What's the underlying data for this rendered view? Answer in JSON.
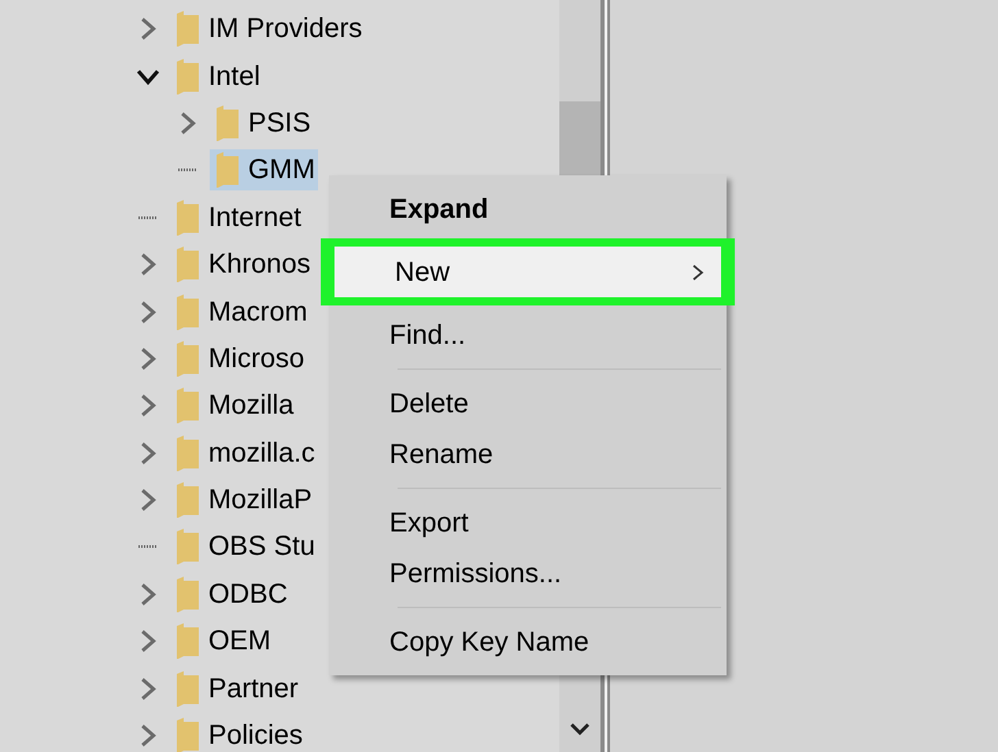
{
  "tree": [
    {
      "label": "IM Providers",
      "has_children": true,
      "expanded": false,
      "selected": false
    },
    {
      "label": "Intel",
      "has_children": true,
      "expanded": true,
      "selected": false,
      "children": [
        {
          "label": "PSIS",
          "has_children": true,
          "expanded": false,
          "selected": false
        },
        {
          "label": "GMM",
          "has_children": false,
          "selected": true
        }
      ]
    },
    {
      "label": "Internet",
      "has_children": false,
      "selected": false
    },
    {
      "label": "Khronos",
      "has_children": true,
      "expanded": false,
      "selected": false
    },
    {
      "label": "Macrom",
      "has_children": true,
      "expanded": false,
      "selected": false
    },
    {
      "label": "Microso",
      "has_children": true,
      "expanded": false,
      "selected": false
    },
    {
      "label": "Mozilla",
      "has_children": true,
      "expanded": false,
      "selected": false
    },
    {
      "label": "mozilla.c",
      "has_children": true,
      "expanded": false,
      "selected": false
    },
    {
      "label": "MozillaP",
      "has_children": true,
      "expanded": false,
      "selected": false
    },
    {
      "label": "OBS Stu",
      "has_children": false,
      "selected": false
    },
    {
      "label": "ODBC",
      "has_children": true,
      "expanded": false,
      "selected": false
    },
    {
      "label": "OEM",
      "has_children": true,
      "expanded": false,
      "selected": false
    },
    {
      "label": "Partner",
      "has_children": true,
      "expanded": false,
      "selected": false
    },
    {
      "label": "Policies",
      "has_children": true,
      "expanded": false,
      "selected": false
    }
  ],
  "context_menu": [
    {
      "kind": "item",
      "label": "Expand",
      "bold": true,
      "submenu": false,
      "selected": false,
      "annotated": false
    },
    {
      "kind": "item",
      "label": "New",
      "bold": false,
      "submenu": true,
      "selected": true,
      "annotated": true
    },
    {
      "kind": "item",
      "label": "Find...",
      "bold": false,
      "submenu": false,
      "selected": false,
      "annotated": false
    },
    {
      "kind": "separator"
    },
    {
      "kind": "item",
      "label": "Delete",
      "bold": false,
      "submenu": false,
      "selected": false,
      "annotated": false
    },
    {
      "kind": "item",
      "label": "Rename",
      "bold": false,
      "submenu": false,
      "selected": false,
      "annotated": false
    },
    {
      "kind": "separator"
    },
    {
      "kind": "item",
      "label": "Export",
      "bold": false,
      "submenu": false,
      "selected": false,
      "annotated": false
    },
    {
      "kind": "item",
      "label": "Permissions...",
      "bold": false,
      "submenu": false,
      "selected": false,
      "annotated": false
    },
    {
      "kind": "separator"
    },
    {
      "kind": "item",
      "label": "Copy Key Name",
      "bold": false,
      "submenu": false,
      "selected": false,
      "annotated": false
    }
  ]
}
